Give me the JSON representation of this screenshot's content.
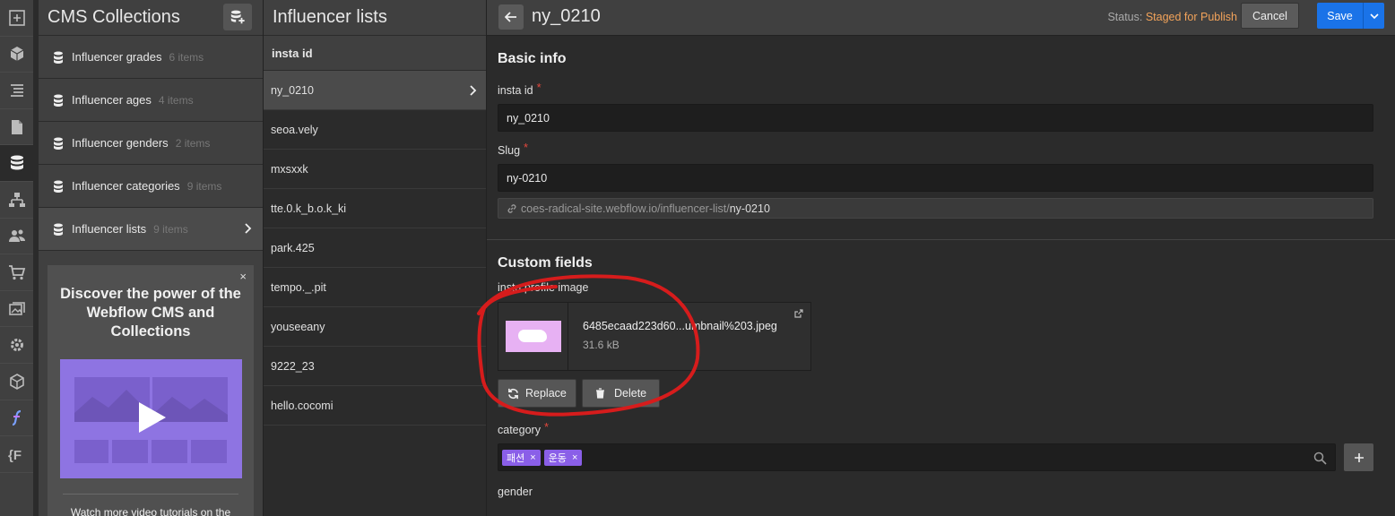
{
  "rail": {
    "icons": [
      "add-panel-icon",
      "box-icon",
      "navigator-icon",
      "pages-icon",
      "cms-database-icon",
      "logic-flow-icon",
      "users-icon",
      "ecommerce-cart-icon",
      "assets-icon",
      "settings-icon",
      "apps-box-icon",
      "finsweet-icon",
      "finsweet-attributes-icon"
    ]
  },
  "cms": {
    "title": "CMS Collections",
    "collections": [
      {
        "name": "Influencer grades",
        "count": "6 items"
      },
      {
        "name": "Influencer ages",
        "count": "4 items"
      },
      {
        "name": "Influencer genders",
        "count": "2 items"
      },
      {
        "name": "Influencer categories",
        "count": "9 items"
      },
      {
        "name": "Influencer lists",
        "count": "9 items"
      }
    ],
    "promo": {
      "close": "×",
      "heading": "Discover the power of the Webflow CMS and Collections",
      "footer": "Watch more video tutorials on the"
    }
  },
  "list": {
    "title": "Influencer lists",
    "column": "insta id",
    "items": [
      "ny_0210",
      "seoa.vely",
      "mxsxxk",
      "tte.0.k_b.o.k_ki",
      "park.425",
      "tempo._.pit",
      "youseeany",
      "9222_23",
      "hello.cocomi"
    ]
  },
  "editor": {
    "title": "ny_0210",
    "status_label": "Status:",
    "status_value": "Staged for Publish",
    "cancel": "Cancel",
    "save": "Save",
    "basic_info": "Basic info",
    "insta_id_label": "insta id",
    "insta_id_value": "ny_0210",
    "slug_label": "Slug",
    "slug_value": "ny-0210",
    "slug_url_base": "coes-radical-site.webflow.io/influencer-list/",
    "slug_url_slug": "ny-0210",
    "custom_fields": "Custom fields",
    "image_label": "insta profile image",
    "file_name": "6485ecaad223d60...umbnail%203.jpeg",
    "file_size": "31.6 kB",
    "replace": "Replace",
    "delete": "Delete",
    "category_label": "category",
    "tags": [
      "패션",
      "운동"
    ],
    "tag_remove": "×",
    "gender_label": "gender",
    "required_mark": "*"
  },
  "colors": {
    "accent": "#1a73e8",
    "status": "#f2a35a",
    "tag": "#8a5fe8",
    "annotation": "#d61c1c"
  }
}
